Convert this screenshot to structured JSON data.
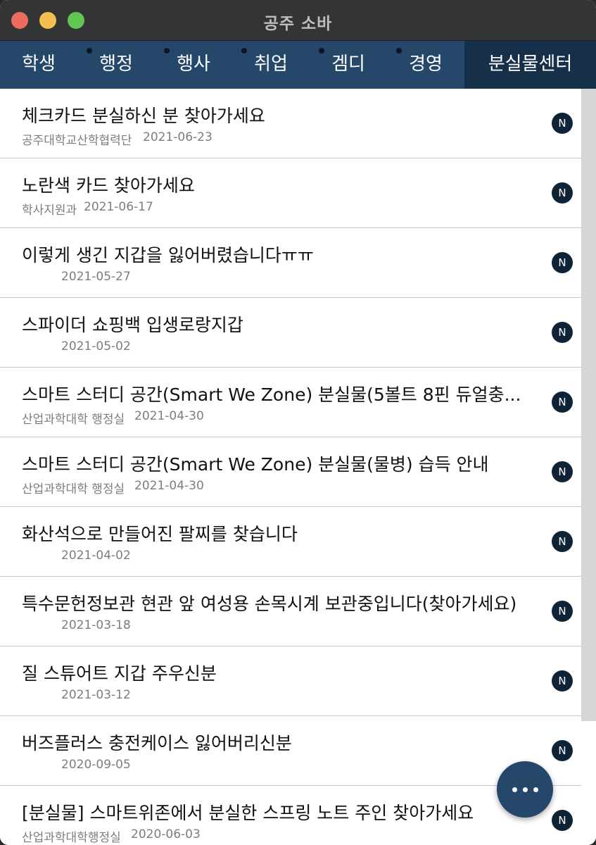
{
  "window": {
    "title": "공주 소바"
  },
  "tabs": [
    {
      "label": "학생",
      "has_dot": false,
      "active": false
    },
    {
      "label": "행정",
      "has_dot": true,
      "active": false
    },
    {
      "label": "행사",
      "has_dot": true,
      "active": false
    },
    {
      "label": "취업",
      "has_dot": true,
      "active": false
    },
    {
      "label": "겜디",
      "has_dot": true,
      "active": false
    },
    {
      "label": "경영",
      "has_dot": true,
      "active": false
    },
    {
      "label": "분실물센터",
      "has_dot": false,
      "active": true
    }
  ],
  "posts": [
    {
      "title": "체크카드 분실하신 분 찾아가세요",
      "dept": "공주대학교산학협력단",
      "date": "2021-06-23",
      "badge": "N"
    },
    {
      "title": "노란색 카드 찾아가세요",
      "dept": "학사지원과",
      "date": "2021-06-17",
      "badge": "N"
    },
    {
      "title": "이렇게 생긴 지갑을 잃어버렸습니다ㅠㅠ",
      "dept": "",
      "date": "2021-05-27",
      "badge": "N"
    },
    {
      "title": "스파이더 쇼핑백 입생로랑지갑",
      "dept": "",
      "date": "2021-05-02",
      "badge": "N"
    },
    {
      "title": "스마트 스터디 공간(Smart We Zone) 분실물(5볼트 8핀 듀얼충...",
      "dept": "산업과학대학 행정실",
      "date": "2021-04-30",
      "badge": "N"
    },
    {
      "title": "스마트 스터디 공간(Smart We Zone) 분실물(물병) 습득 안내",
      "dept": "산업과학대학 행정실",
      "date": "2021-04-30",
      "badge": "N"
    },
    {
      "title": "화산석으로 만들어진 팔찌를 찾습니다",
      "dept": "",
      "date": "2021-04-02",
      "badge": "N"
    },
    {
      "title": "특수문헌정보관 현관 앞 여성용 손목시계 보관중입니다(찾아가세요)",
      "dept": "",
      "date": "2021-03-18",
      "badge": "N"
    },
    {
      "title": "질 스튜어트 지갑 주우신분",
      "dept": "",
      "date": "2021-03-12",
      "badge": "N"
    },
    {
      "title": "버즈플러스 충전케이스 잃어버리신분",
      "dept": "",
      "date": "2020-09-05",
      "badge": "N"
    },
    {
      "title": "[분실물] 스마트위존에서 분실한 스프링 노트 주인 찾아가세요",
      "dept": "산업과학대학행정실",
      "date": "2020-06-03",
      "badge": "N"
    }
  ],
  "fab": {
    "icon": "more-horizontal-icon"
  },
  "colors": {
    "tabbar": "#25476a",
    "tab_active": "#17304a",
    "badge": "#0f2336"
  }
}
